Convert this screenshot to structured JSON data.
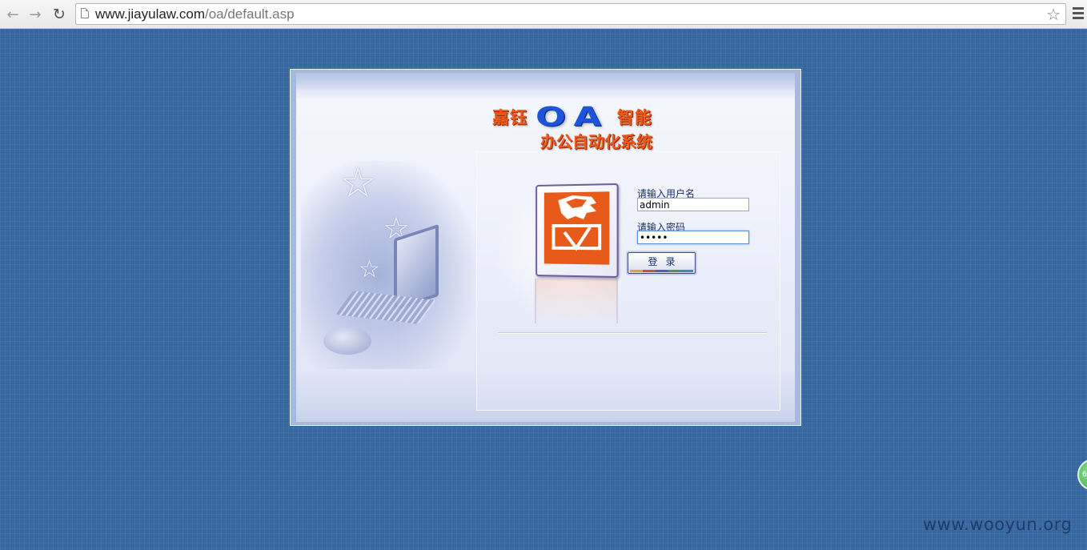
{
  "browser": {
    "url_host": "www.jiayulaw.com",
    "url_path": "/oa/default.asp",
    "icons": {
      "back": "back-arrow-icon",
      "forward": "forward-arrow-icon",
      "reload": "reload-icon",
      "page": "page-icon",
      "bookmark": "bookmark-star-icon",
      "menu": "menu-icon"
    }
  },
  "logo": {
    "left_word": "嘉钰",
    "mark": "OA",
    "right_word": "智能",
    "subtitle": "办公自动化系统"
  },
  "form": {
    "username_label": "请输入用户名",
    "username_value": "admin",
    "password_label": "请输入密码",
    "password_value": "•••••",
    "submit_label": "登录"
  },
  "side_widget": {
    "text": "6"
  },
  "watermark": "www.wooyun.org",
  "colors": {
    "page_background": "#36679f",
    "title_orange": "#ee5a1a",
    "oa_blue": "#1d54d8",
    "label_text": "#1a2d6b"
  }
}
